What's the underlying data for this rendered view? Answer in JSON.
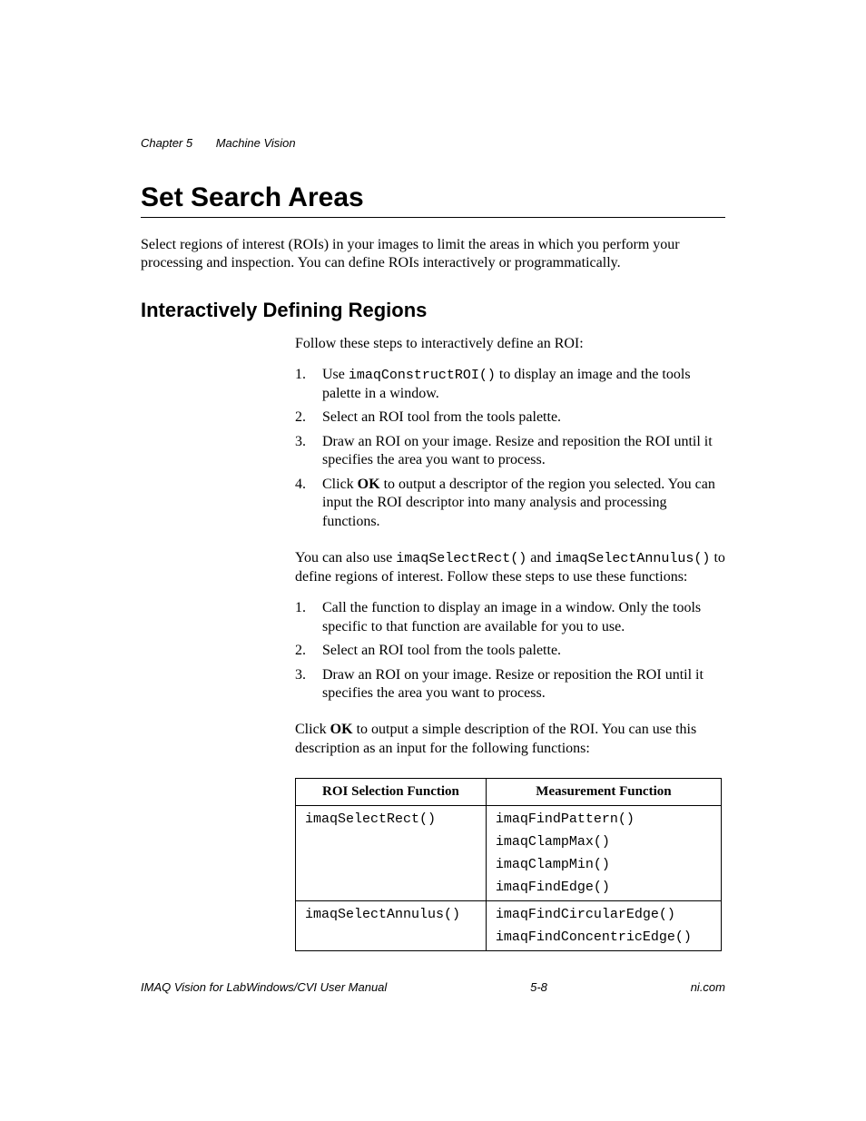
{
  "header": {
    "chapter": "Chapter 5",
    "title": "Machine Vision"
  },
  "h1": "Set Search Areas",
  "intro": "Select regions of interest (ROIs) in your images to limit the areas in which you perform your processing and inspection. You can define ROIs interactively or programmatically.",
  "h2": "Interactively Defining Regions",
  "lead1": "Follow these steps to interactively define an ROI:",
  "steps1": {
    "s1_pre": "Use ",
    "s1_code": "imaqConstructROI()",
    "s1_post": " to display an image and the tools palette in a window.",
    "s2": "Select an ROI tool from the tools palette.",
    "s3": "Draw an ROI on your image. Resize and reposition the ROI until it specifies the area you want to process.",
    "s4_pre": "Click ",
    "s4_bold": "OK",
    "s4_post": " to output a descriptor of the region you selected. You can input the ROI descriptor into many analysis and processing functions."
  },
  "para2_pre": "You can also use ",
  "para2_code1": "imaqSelectRect()",
  "para2_mid": " and ",
  "para2_code2": "imaqSelectAnnulus()",
  "para2_post": " to define regions of interest. Follow these steps to use these functions:",
  "steps2": {
    "s1": "Call the function to display an image in a window. Only the tools specific to that function are available for you to use.",
    "s2": "Select an ROI tool from the tools palette.",
    "s3": "Draw an ROI on your image. Resize or reposition the ROI until it specifies the area you want to process."
  },
  "para3_pre": "Click ",
  "para3_bold": "OK",
  "para3_post": " to output a simple description of the ROI. You can use this description as an input for the following functions:",
  "table": {
    "th1": "ROI Selection Function",
    "th2": "Measurement Function",
    "r1c1": "imaqSelectRect()",
    "r1c2a": "imaqFindPattern()",
    "r1c2b": "imaqClampMax()",
    "r1c2c": "imaqClampMin()",
    "r1c2d": "imaqFindEdge()",
    "r2c1": "imaqSelectAnnulus()",
    "r2c2a": "imaqFindCircularEdge()",
    "r2c2b": "imaqFindConcentricEdge()"
  },
  "footer": {
    "left": "IMAQ Vision for LabWindows/CVI User Manual",
    "center": "5-8",
    "right": "ni.com"
  }
}
